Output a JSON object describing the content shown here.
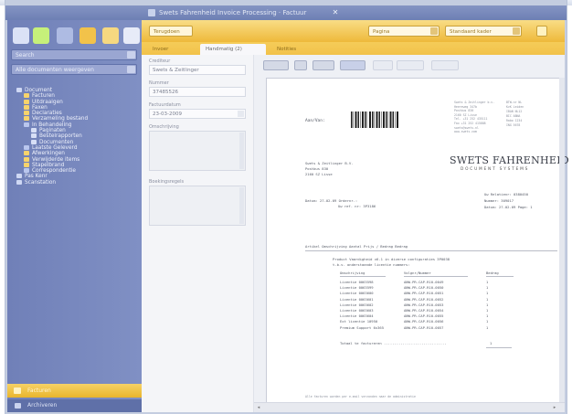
{
  "titlebar": {
    "text": "Swets Fahrenheid Invoice Processing · Factuur"
  },
  "sidebar": {
    "search_field": "Search",
    "filter_field": "Alle documenten weergeven",
    "tree": [
      {
        "label": "Document",
        "level": 0,
        "color": "#cfd8f4"
      },
      {
        "label": "Facturen",
        "level": 1,
        "color": "#f7d36b"
      },
      {
        "label": "Uitdraaigen",
        "level": 1,
        "color": "#f7d36b"
      },
      {
        "label": "Faxen",
        "level": 1,
        "color": "#f7d36b"
      },
      {
        "label": "Declaraties",
        "level": 1,
        "color": "#f7d36b"
      },
      {
        "label": "Verzameling bestand",
        "level": 1,
        "color": "#f7d36b"
      },
      {
        "label": "In Behandeling",
        "level": 1,
        "color": "#b9c6ee"
      },
      {
        "label": "Paginaten",
        "level": 2,
        "color": "#d7dff6"
      },
      {
        "label": "Bestelrapporten",
        "level": 2,
        "color": "#d7dff6"
      },
      {
        "label": "Documenten",
        "level": 2,
        "color": "#d7dff6"
      },
      {
        "label": "Laatste Geleverd",
        "level": 1,
        "color": "#b9c6ee"
      },
      {
        "label": "Afwerkingen",
        "level": 1,
        "color": "#f7d36b"
      },
      {
        "label": "Verwijderde items",
        "level": 1,
        "color": "#f7d36b"
      },
      {
        "label": "Stapelbrand",
        "level": 1,
        "color": "#f7d36b"
      },
      {
        "label": "Correspondentie",
        "level": 1,
        "color": "#b9c6ee"
      },
      {
        "label": "Pas Kenr",
        "level": 0,
        "color": "#cfd8f4"
      },
      {
        "label": "Scanstation",
        "level": 0,
        "color": "#cfd8f4"
      }
    ],
    "bottom_active_label": "Facturen",
    "bottom_label": "Archiveren"
  },
  "toolbar": {
    "back_label": "Terugdoen",
    "combo1": "Pagina",
    "combo2": "Standaard kader"
  },
  "tabs": [
    {
      "label": "Invoer",
      "active": false
    },
    {
      "label": "Handmatig (2)",
      "active": true
    },
    {
      "label": "Notities",
      "active": false
    }
  ],
  "form": {
    "field1_label": "Crediteur",
    "field1_value": "Swets & Zeitlinger",
    "field2_label": "Nummer",
    "field2_value": "37485526",
    "field3_label": "Factuurdatum",
    "field3_value": "23-03-2009",
    "field4_label": "Omschrijving",
    "field5_label": "Boekingsregels"
  },
  "document": {
    "sender_label": "Aan/Van:",
    "addr_small": [
      "Swets & Zeitlinger b.v.",
      "Heereweg 347b",
      "Postbus 830",
      "2160 SZ Lisse",
      "Tel. +31 252 435111",
      "Fax +31 252 415888",
      "swets@swets.nl",
      "www.swets.com"
    ],
    "addr_small2": [
      "BTW-nr NL",
      "KvK Leiden",
      "IBAN NL12",
      "BIC ABNA",
      "Rabo 1234",
      "ING 5678"
    ],
    "recipient": [
      "Swets & Zeitlinger B.V.",
      "Postbus 830",
      "2160 SZ Lisse"
    ],
    "logo_title": "SWETS FAHRENHEID",
    "logo_subtitle": "DOCUMENT SYSTEMS",
    "ref_line1": "Datum: 27-02-09     Ordernr.:",
    "ref_line2": "Uw ref. nr: 3P3186",
    "ref_right1": "Uw Relatienr: 0380450",
    "ref_right2": "Nummer:  309017",
    "ref_right3": "Datum: 27-02-09  Page: 1",
    "table_header": "Artikel   Omschrijving              Aantal    Prijs / Bedrag    Bedrag",
    "intro1": "Product Vaardigheid v6.1 in diverse configuraties 3P0038",
    "intro2": "t.b.v. onderstaande licentie nummers:",
    "col_a": "Omschrijving",
    "col_b": "Volgnr/Nummer",
    "col_c": "Bedrag",
    "rows": [
      [
        "Licentie 0063598",
        "ANW-PR-CAP-R10-0049",
        "1"
      ],
      [
        "Licentie 0063599",
        "ANW-PR-CAP-R10-0050",
        "1"
      ],
      [
        "Licentie 0063600",
        "ANW-PR-CAP-R10-0051",
        "1"
      ],
      [
        "Licentie 0063601",
        "ANW-PR-CAP-R10-0052",
        "1"
      ],
      [
        "Licentie 0063602",
        "ANW-PR-CAP-R10-0053",
        "1"
      ],
      [
        "Licentie 0063603",
        "ANW-PR-CAP-R10-0054",
        "1"
      ],
      [
        "Licentie 0063604",
        "ANW-PR-CAP-R10-0055",
        "1"
      ],
      [
        "Ext licentie 10950",
        "ANW-PR-CAP-R10-0056",
        "1"
      ],
      [
        "Premium Support 6x365",
        "ANW-PR-CAP-R10-0057",
        "1"
      ]
    ],
    "total_line": "Totaal te factureren ..............................",
    "total_value": "1",
    "footer": "Alle facturen worden per e-mail verzonden naar de administratie"
  },
  "colors": {
    "sidebar": "#7585bb",
    "accent_yellow": "#f2c24a"
  }
}
